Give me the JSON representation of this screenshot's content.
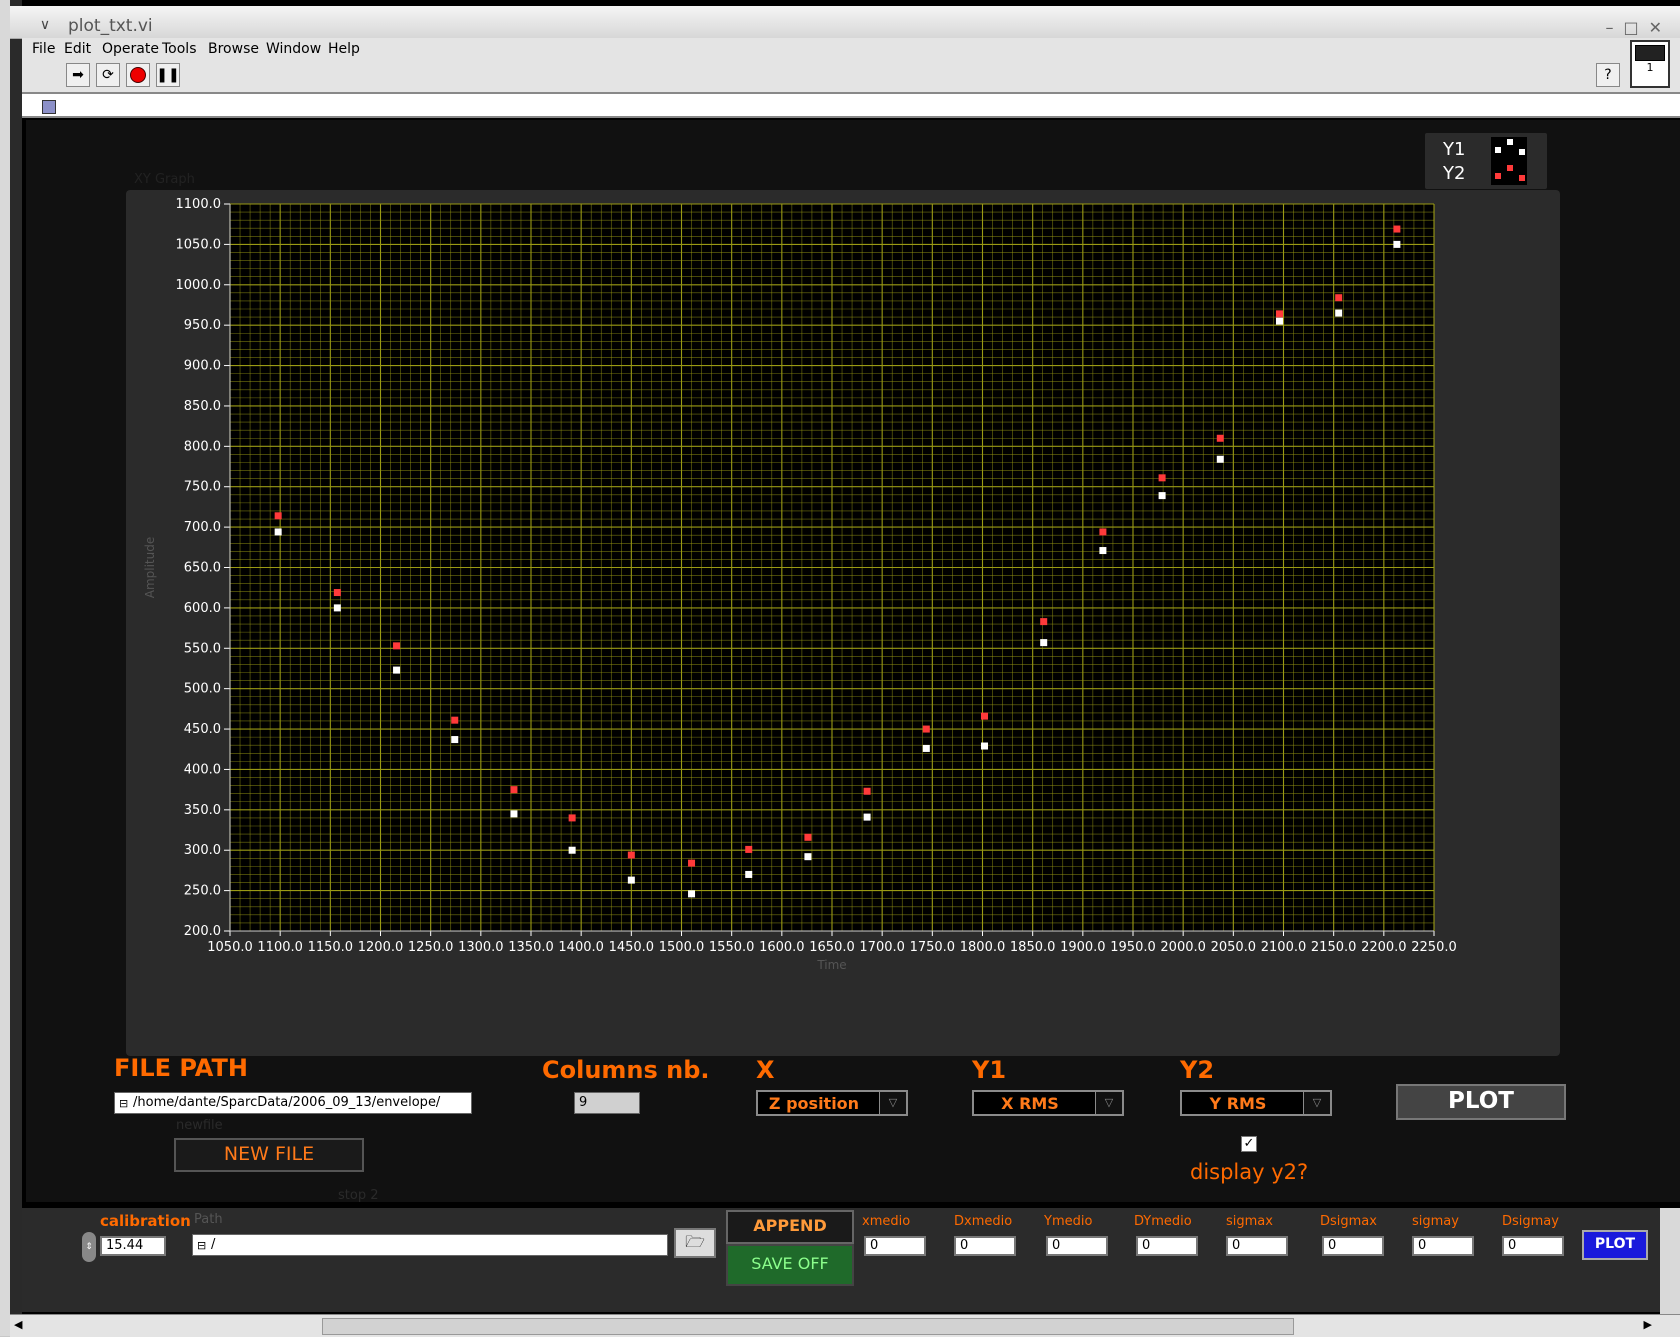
{
  "window": {
    "title": "plot_txt.vi",
    "controls": [
      "–",
      "□",
      "✕"
    ]
  },
  "menubar": {
    "items": [
      "File",
      "Edit",
      "Operate",
      "Tools",
      "Browse",
      "Window",
      "Help"
    ]
  },
  "toolbar": {
    "buttons": [
      "run-arrow-icon",
      "run-continuously-icon",
      "abort-icon",
      "pause-icon"
    ],
    "help": "?",
    "vi_icon_label": "1"
  },
  "graph": {
    "label": "XY Graph",
    "legend": [
      "Y1",
      "Y2"
    ],
    "colors": {
      "y1": "#ffffff",
      "y2": "#ff3a3a",
      "grid": "#9a9a14",
      "plot_bg": "#000000"
    }
  },
  "chart_data": {
    "type": "scatter",
    "xlabel": "Time",
    "ylabel": "Amplitude",
    "xlim": [
      1050,
      2250
    ],
    "ylim": [
      200,
      1100
    ],
    "x_ticks": [
      "1050.0",
      "1100.0",
      "1150.0",
      "1200.0",
      "1250.0",
      "1300.0",
      "1350.0",
      "1400.0",
      "1450.0",
      "1500.0",
      "1550.0",
      "1600.0",
      "1650.0",
      "1700.0",
      "1750.0",
      "1800.0",
      "1850.0",
      "1900.0",
      "1950.0",
      "2000.0",
      "2050.0",
      "2100.0",
      "2150.0",
      "2200.0",
      "2250.0"
    ],
    "y_ticks": [
      "200.0",
      "250.0",
      "300.0",
      "350.0",
      "400.0",
      "450.0",
      "500.0",
      "550.0",
      "600.0",
      "650.0",
      "700.0",
      "750.0",
      "800.0",
      "850.0",
      "900.0",
      "950.0",
      "1000.0",
      "1050.0",
      "1100.0"
    ],
    "x": [
      1098,
      1157,
      1216,
      1274,
      1333,
      1391,
      1450,
      1510,
      1567,
      1626,
      1685,
      1744,
      1802,
      1861,
      1920,
      1979,
      2037,
      2096,
      2155,
      2213
    ],
    "series": [
      {
        "name": "Y1",
        "color": "#ffffff",
        "values": [
          694,
          600,
          523,
          437,
          345,
          300,
          263,
          246,
          270,
          292,
          341,
          426,
          429,
          557,
          671,
          739,
          784,
          955,
          965,
          1050
        ]
      },
      {
        "name": "Y2",
        "color": "#ff3a3a",
        "values": [
          714,
          619,
          553,
          461,
          375,
          340,
          294,
          284,
          301,
          316,
          373,
          450,
          466,
          583,
          694,
          761,
          810,
          964,
          984,
          1069
        ]
      }
    ]
  },
  "controls": {
    "file_path_label": "FILE PATH",
    "file_path_value": "/home/dante/SparcData/2006_09_13/envelope/",
    "newfile_caption": "newfile",
    "new_file_button": "NEW FILE",
    "columns_label": "Columns nb.",
    "columns_value": "9",
    "x_label": "X",
    "x_value": "Z position",
    "y1_label": "Y1",
    "y1_value": "X RMS",
    "y2_label": "Y2",
    "y2_value": "Y RMS",
    "plot_button": "PLOT",
    "display_y2_label": "display y2?",
    "display_y2_checked": true,
    "stop_caption": "stop 2"
  },
  "bottom": {
    "calibration_label": "calibration",
    "calibration_value": "15.44",
    "path_label": "Path",
    "path_value": "/",
    "append_button": "APPEND",
    "save_button": "SAVE OFF",
    "indicators": [
      {
        "label": "xmedio",
        "value": "0"
      },
      {
        "label": "Dxmedio",
        "value": "0"
      },
      {
        "label": "Ymedio",
        "value": "0"
      },
      {
        "label": "DYmedio",
        "value": "0"
      },
      {
        "label": "sigmax",
        "value": "0"
      },
      {
        "label": "Dsigmax",
        "value": "0"
      },
      {
        "label": "sigmay",
        "value": "0"
      },
      {
        "label": "Dsigmay",
        "value": "0"
      }
    ],
    "plot_button": "PLOT"
  }
}
